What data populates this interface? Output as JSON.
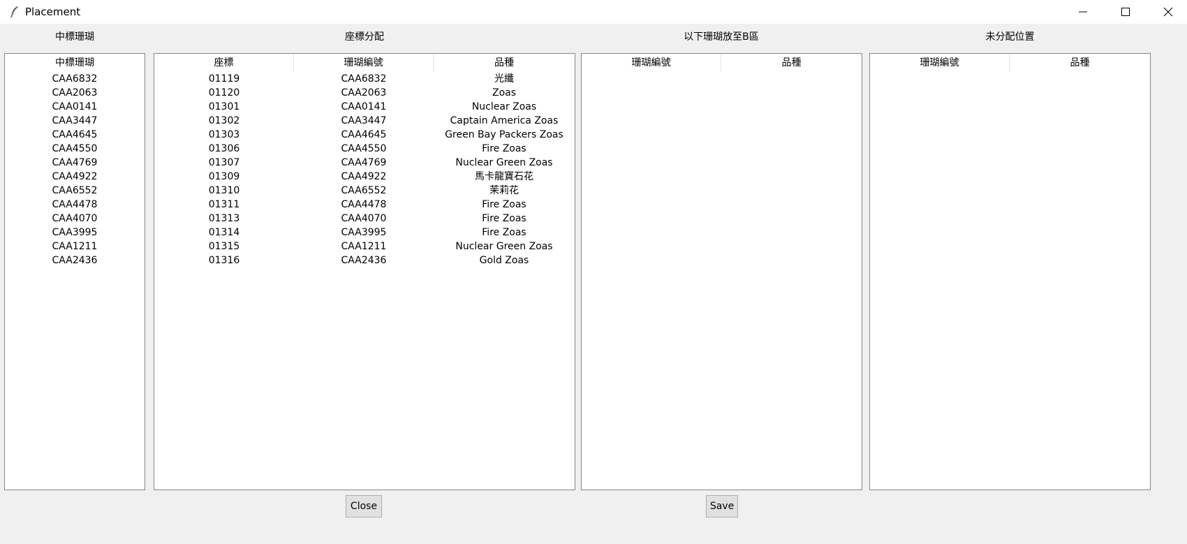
{
  "window": {
    "title": "Placement",
    "app_icon": "feather-icon",
    "controls": [
      "minimize-icon",
      "maximize-icon",
      "close-icon"
    ]
  },
  "headings": {
    "winning": "中標珊瑚",
    "assignment": "座標分配",
    "area_b": "以下珊瑚放至B區",
    "unassigned": "未分配位置"
  },
  "winning_list": {
    "header": "中標珊瑚",
    "items": [
      "CAA6832",
      "CAA2063",
      "CAA0141",
      "CAA3447",
      "CAA4645",
      "CAA4550",
      "CAA4769",
      "CAA4922",
      "CAA6552",
      "CAA4478",
      "CAA4070",
      "CAA3995",
      "CAA1211",
      "CAA2436"
    ]
  },
  "assignment_table": {
    "columns": [
      "座標",
      "珊瑚編號",
      "品種"
    ],
    "rows": [
      [
        "01119",
        "CAA6832",
        "光纖"
      ],
      [
        "01120",
        "CAA2063",
        "Zoas"
      ],
      [
        "01301",
        "CAA0141",
        "Nuclear Zoas"
      ],
      [
        "01302",
        "CAA3447",
        "Captain America Zoas"
      ],
      [
        "01303",
        "CAA4645",
        "Green Bay Packers Zoas"
      ],
      [
        "01306",
        "CAA4550",
        "Fire Zoas"
      ],
      [
        "01307",
        "CAA4769",
        "Nuclear Green Zoas"
      ],
      [
        "01309",
        "CAA4922",
        "馬卡龍寶石花"
      ],
      [
        "01310",
        "CAA6552",
        "茉莉花"
      ],
      [
        "01311",
        "CAA4478",
        "Fire Zoas"
      ],
      [
        "01313",
        "CAA4070",
        "Fire Zoas"
      ],
      [
        "01314",
        "CAA3995",
        "Fire Zoas"
      ],
      [
        "01315",
        "CAA1211",
        "Nuclear Green Zoas"
      ],
      [
        "01316",
        "CAA2436",
        "Gold Zoas"
      ]
    ]
  },
  "area_b_table": {
    "columns": [
      "珊瑚編號",
      "品種"
    ],
    "rows": []
  },
  "unassigned_table": {
    "columns": [
      "珊瑚編號",
      "品種"
    ],
    "rows": []
  },
  "buttons": {
    "close": "Close",
    "save": "Save"
  }
}
